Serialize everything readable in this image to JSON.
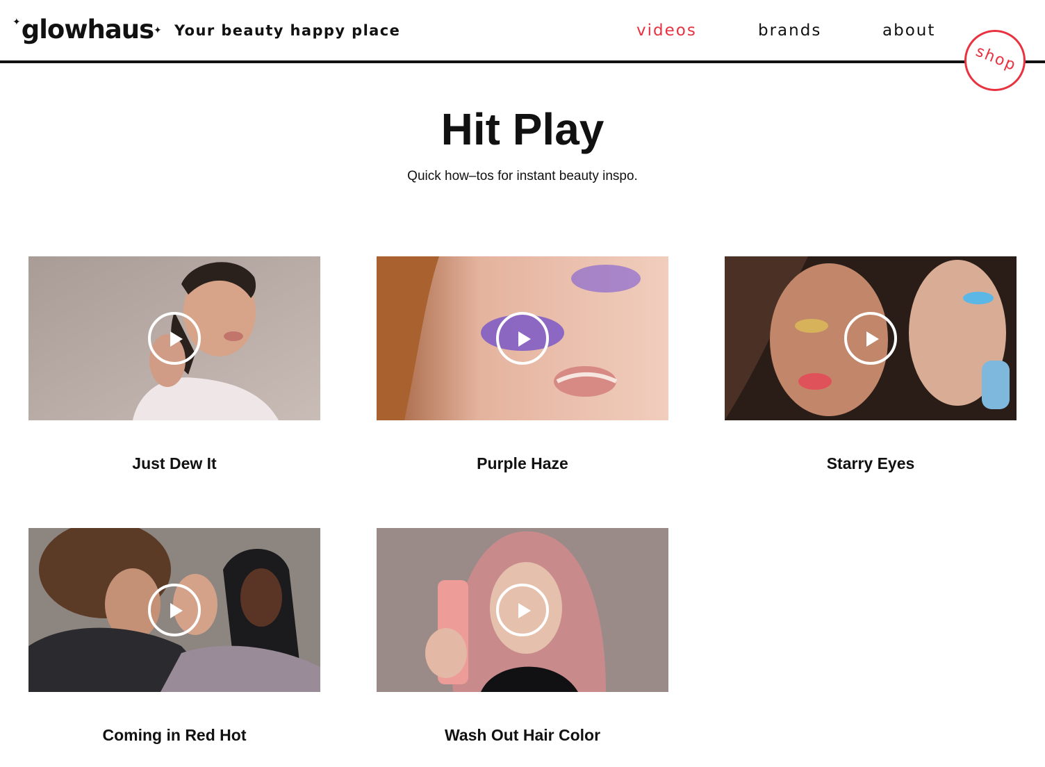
{
  "brand": {
    "logo": "glowhaus",
    "spark_glyph": "✦",
    "tagline": "Your beauty happy place"
  },
  "nav": {
    "items": [
      {
        "label": "videos",
        "active": true
      },
      {
        "label": "brands",
        "active": false
      },
      {
        "label": "about",
        "active": false
      }
    ],
    "shop_label": "shop"
  },
  "hero": {
    "title": "Hit Play",
    "subtitle": "Quick how–tos for instant beauty inspo."
  },
  "videos": [
    {
      "title": "Just Dew It",
      "icon": "play-icon"
    },
    {
      "title": "Purple Haze",
      "icon": "play-icon"
    },
    {
      "title": "Starry Eyes",
      "icon": "play-icon"
    },
    {
      "title": "Coming in Red Hot",
      "icon": "play-icon"
    },
    {
      "title": "Wash Out Hair Color",
      "icon": "play-icon"
    }
  ],
  "colors": {
    "accent": "#e8323f",
    "text": "#111111",
    "background": "#ffffff"
  }
}
